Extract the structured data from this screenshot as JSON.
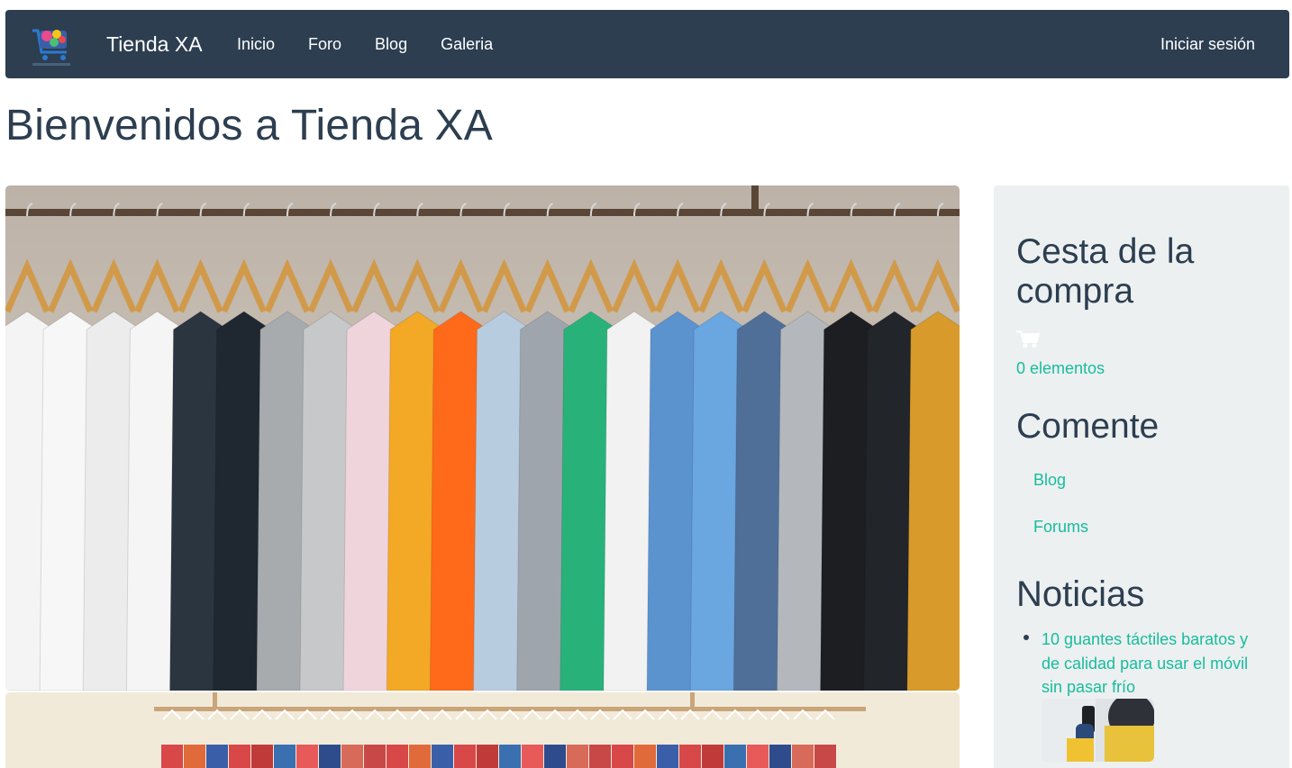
{
  "navbar": {
    "logo_icon": "store-cart-logo",
    "brand": "Tienda XA",
    "links": [
      "Inicio",
      "Foro",
      "Blog",
      "Galeria"
    ],
    "login": "Iniciar sesión"
  },
  "main": {
    "title": "Bienvenidos a Tienda XA"
  },
  "sidebar": {
    "cart": {
      "title": "Cesta de la compra",
      "icon": "shopping-cart-icon",
      "count": "0 elementos"
    },
    "comment": {
      "title": "Comente",
      "links": [
        "Blog",
        "Forums"
      ]
    },
    "news": {
      "title": "Noticias",
      "items": [
        {
          "title": "10 guantes táctiles baratos y de calidad para usar el móvil sin pasar frío"
        }
      ]
    }
  },
  "colors": {
    "navbar_bg": "#2c3e50",
    "link": "#18bc9c",
    "sidebar_bg": "#ecf0f1",
    "text": "#2c3e50"
  }
}
